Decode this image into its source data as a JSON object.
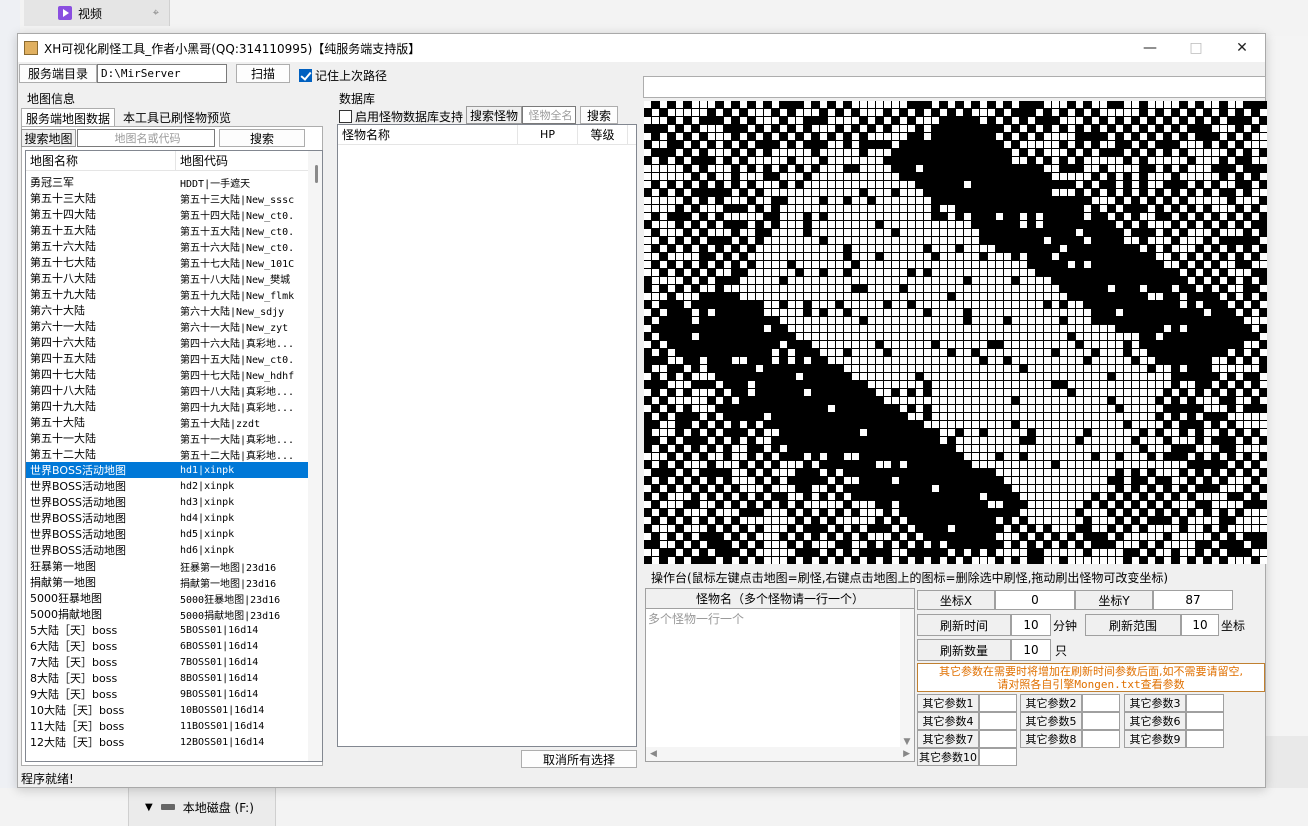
{
  "background": {
    "video_label": "视频",
    "drive_label": "本地磁盘 (F:)"
  },
  "window": {
    "title": "XH可视化刷怪工具_作者小黑哥(QQ:314110995)【纯服务端支持版】"
  },
  "server": {
    "label": "服务端目录",
    "path": "D:\\MirServer",
    "scan_label": "扫描",
    "remember_label": "记住上次路径",
    "remember_checked": true
  },
  "map_info": {
    "group_label": "地图信息",
    "tabs": [
      "服务端地图数据",
      "本工具已刷怪物预览"
    ],
    "search_label": "搜索地图",
    "search_placeholder": "地图名或代码",
    "search_button": "搜索",
    "columns": [
      "地图名称",
      "地图代码"
    ],
    "selected_index": 18,
    "rows": [
      [
        "勇冠三军",
        "HDDT|一手遮天"
      ],
      [
        "第五十三大陆",
        "第五十三大陆|New_sssc"
      ],
      [
        "第五十四大陆",
        "第五十四大陆|New_ct0."
      ],
      [
        "第五十五大陆",
        "第五十五大陆|New_ct0."
      ],
      [
        "第五十六大陆",
        "第五十六大陆|New_ct0."
      ],
      [
        "第五十七大陆",
        "第五十七大陆|New_101C"
      ],
      [
        "第五十八大陆",
        "第五十八大陆|New_樊城"
      ],
      [
        "第五十九大陆",
        "第五十九大陆|New_flmk"
      ],
      [
        "第六十大陆",
        "第六十大陆|New_sdjy"
      ],
      [
        "第六十一大陆",
        "第六十一大陆|New_zyt"
      ],
      [
        "第四十六大陆",
        "第四十六大陆|真彩地..."
      ],
      [
        "第四十五大陆",
        "第四十五大陆|New_ct0."
      ],
      [
        "第四十七大陆",
        "第四十七大陆|New_hdhf"
      ],
      [
        "第四十八大陆",
        "第四十八大陆|真彩地..."
      ],
      [
        "第四十九大陆",
        "第四十九大陆|真彩地..."
      ],
      [
        "第五十大陆",
        "第五十大陆|zzdt"
      ],
      [
        "第五十一大陆",
        "第五十一大陆|真彩地..."
      ],
      [
        "第五十二大陆",
        "第五十二大陆|真彩地..."
      ],
      [
        "世界BOSS活动地图",
        "hd1|xinpk"
      ],
      [
        "世界BOSS活动地图",
        "hd2|xinpk"
      ],
      [
        "世界BOSS活动地图",
        "hd3|xinpk"
      ],
      [
        "世界BOSS活动地图",
        "hd4|xinpk"
      ],
      [
        "世界BOSS活动地图",
        "hd5|xinpk"
      ],
      [
        "世界BOSS活动地图",
        "hd6|xinpk"
      ],
      [
        "狂暴第一地图",
        "狂暴第一地图|23d16"
      ],
      [
        "捐献第一地图",
        "捐献第一地图|23d16"
      ],
      [
        "5000狂暴地图",
        "5000狂暴地图|23d16"
      ],
      [
        "5000捐献地图",
        "5000捐献地图|23d16"
      ],
      [
        "5大陆［天］boss",
        "5BOSS01|16d14"
      ],
      [
        "6大陆［天］boss",
        "6BOSS01|16d14"
      ],
      [
        "7大陆［天］boss",
        "7BOSS01|16d14"
      ],
      [
        "8大陆［天］boss",
        "8BOSS01|16d14"
      ],
      [
        "9大陆［天］boss",
        "9BOSS01|16d14"
      ],
      [
        "10大陆［天］boss",
        "10BOSS01|16d14"
      ],
      [
        "11大陆［天］boss",
        "11BOSS01|16d14"
      ],
      [
        "12大陆［天］boss",
        "12BOSS01|16d14"
      ]
    ]
  },
  "database": {
    "group_label": "数据库",
    "enable_label": "启用怪物数据库支持",
    "enable_checked": false,
    "search_monster_label": "搜索怪物",
    "monster_name_placeholder": "怪物全名",
    "search_button": "搜索",
    "columns": [
      "怪物名称",
      "HP",
      "等级"
    ],
    "cancel_all_label": "取消所有选择"
  },
  "operation": {
    "header": "操作台(鼠标左键点击地图=刷怪,右键点击地图上的图标=删除选中刷怪,拖动刷出怪物可改变坐标)",
    "monster_names_label": "怪物名（多个怪物请一行一个）",
    "monster_names_placeholder": "多个怪物一行一个",
    "coord_x_label": "坐标X",
    "coord_x": "0",
    "coord_y_label": "坐标Y",
    "coord_y": "87",
    "refresh_time_label": "刷新时间",
    "refresh_time": "10",
    "minute_unit": "分钟",
    "refresh_range_label": "刷新范围",
    "refresh_range": "10",
    "coord_unit": "坐标",
    "refresh_count_label": "刷新数量",
    "refresh_count": "10",
    "count_unit": "只",
    "note_line1": "其它参数在需要时将增加在刷新时间参数后面,如不需要请留空,",
    "note_line2": "请对照各自引擎Mongen.txt查看参数",
    "params": [
      "其它参数1",
      "其它参数2",
      "其它参数3",
      "其它参数4",
      "其它参数5",
      "其它参数6",
      "其它参数7",
      "其它参数8",
      "其它参数9",
      "其它参数10"
    ]
  },
  "status": "程序就绪!"
}
